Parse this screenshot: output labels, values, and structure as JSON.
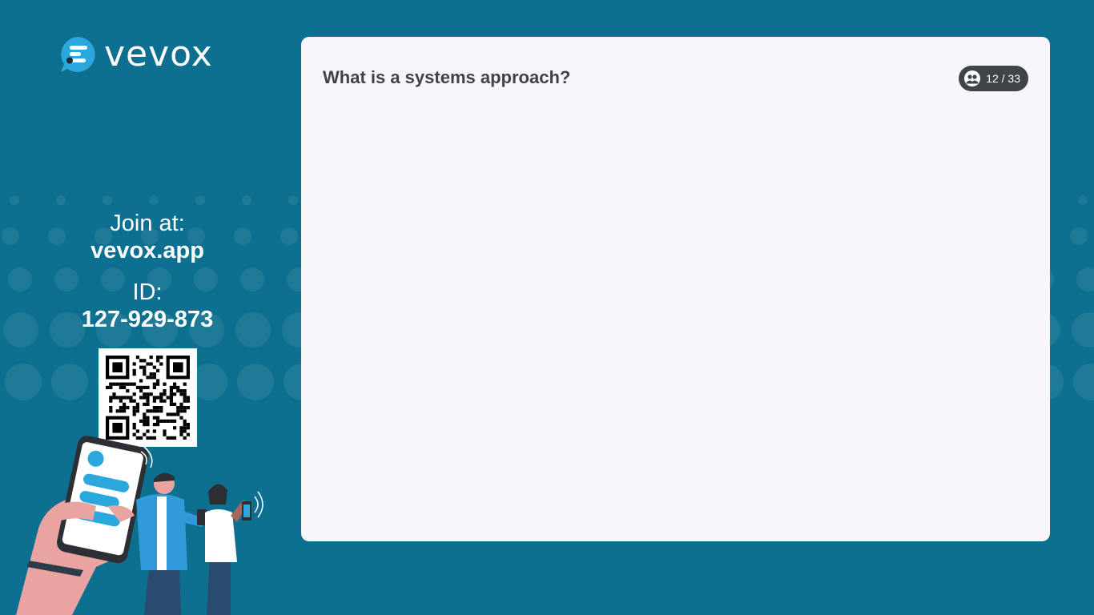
{
  "brand": {
    "name": "vevox",
    "logo_icon": "vevox-speech-bubble-icon"
  },
  "join": {
    "label": "Join at:",
    "url": "vevox.app",
    "id_label": "ID:",
    "id_value": "127-929-873"
  },
  "qr": {
    "icon": "qr-code-icon"
  },
  "slide": {
    "question": "What is a systems approach?",
    "counter": "12 / 33",
    "counter_icon": "participants-icon"
  },
  "colors": {
    "background": "#0e7091",
    "card": "#f8f6fa",
    "question_text": "#3f4346",
    "counter_badge": "#3e4447",
    "brand_accent": "#2aa8de"
  }
}
